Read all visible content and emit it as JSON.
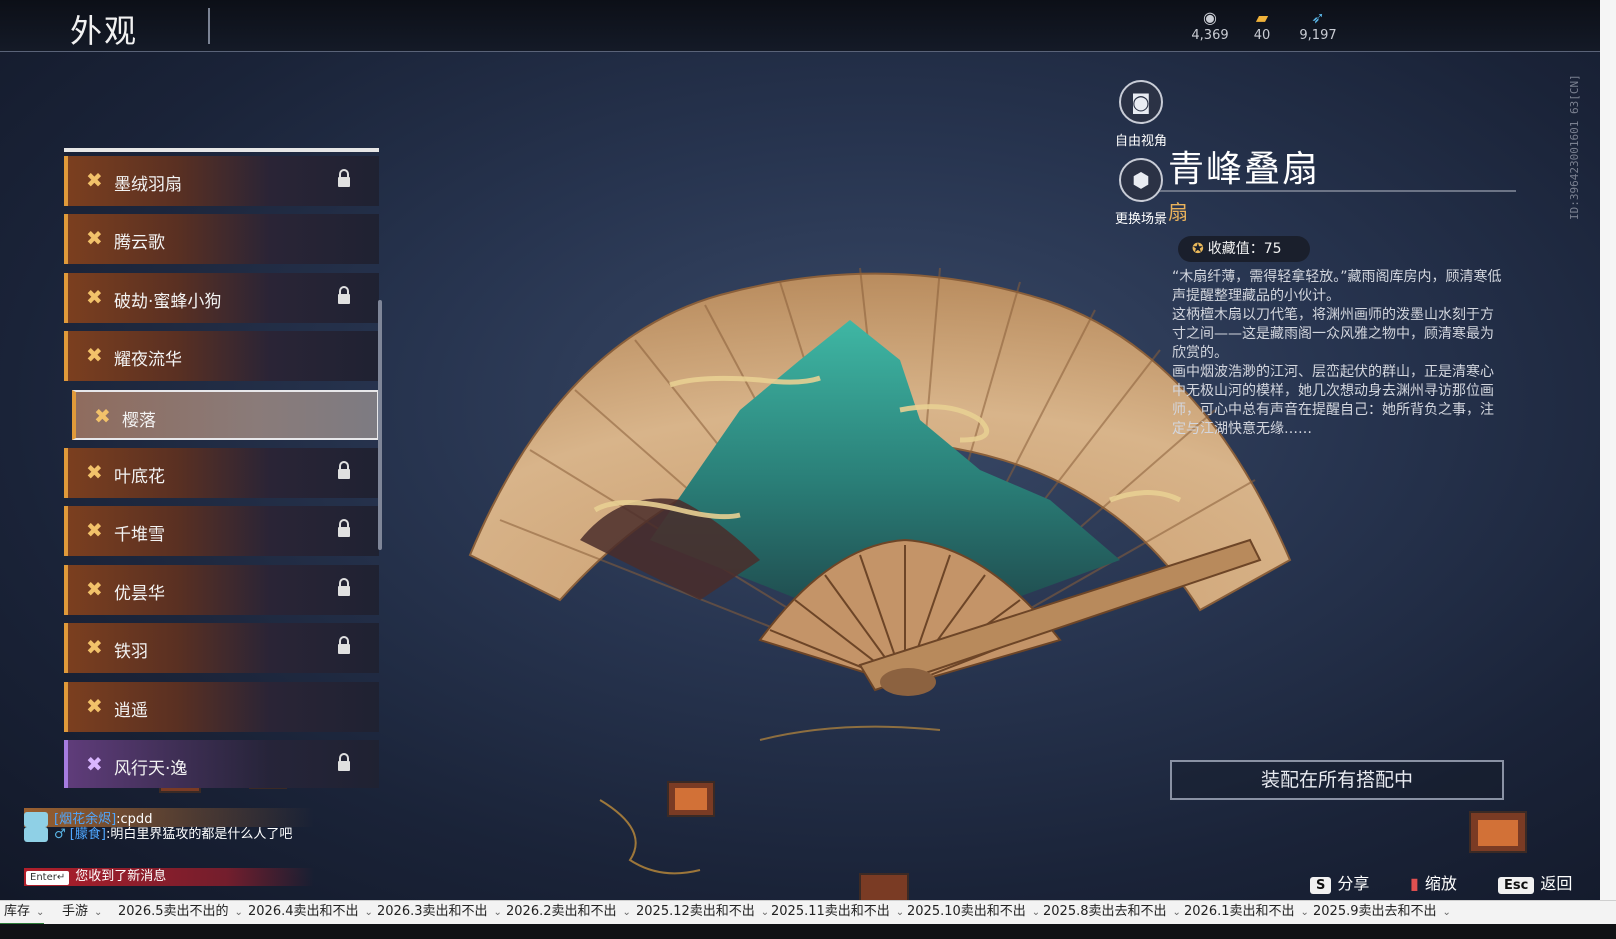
{
  "header": {
    "title": "外观",
    "currencies": [
      {
        "icon": "eye-currency-icon",
        "value": "4,369"
      },
      {
        "icon": "ticket-currency-icon",
        "value": "40"
      },
      {
        "icon": "feather-currency-icon",
        "value": "9,197"
      }
    ],
    "account_id": "ID:396423001601 63[CN]"
  },
  "tools": {
    "free_view": "自由视角",
    "change_scene": "更换场景"
  },
  "list": {
    "items": [
      {
        "label": "墨绒羽扇",
        "locked": true,
        "quality": "orange"
      },
      {
        "label": "腾云歌",
        "locked": false,
        "quality": "orange"
      },
      {
        "label": "破劫·蜜蜂小狗",
        "locked": true,
        "quality": "orange"
      },
      {
        "label": "耀夜流华",
        "locked": false,
        "quality": "orange"
      },
      {
        "label": "樱落",
        "locked": false,
        "quality": "orange",
        "selected": true
      },
      {
        "label": "叶底花",
        "locked": true,
        "quality": "orange"
      },
      {
        "label": "千堆雪",
        "locked": true,
        "quality": "orange"
      },
      {
        "label": "优昙华",
        "locked": true,
        "quality": "orange"
      },
      {
        "label": "铁羽",
        "locked": true,
        "quality": "orange"
      },
      {
        "label": "逍遥",
        "locked": false,
        "quality": "orange"
      },
      {
        "label": "风行天·逸",
        "locked": true,
        "quality": "purple"
      }
    ]
  },
  "detail": {
    "name": "青峰叠扇",
    "type": "扇",
    "collection_label": "收藏值：75",
    "description": [
      "“木扇纤薄，需得轻拿轻放。”藏雨阁库房内，顾清寒低声提醒整理藏品的小伙计。",
      "这柄檀木扇以刀代笔，将渊州画师的泼墨山水刻于方寸之间——这是藏雨阁一众风雅之物中，顾清寒最为欣赏的。",
      "画中烟波浩渺的江河、层峦起伏的群山，正是清寒心中无极山河的模样，她几次想动身去渊州寻访那位画师，可心中总有声音在提醒自己：她所背负之事，注定与江湖快意无缘……"
    ],
    "equip_button": "装配在所有搭配中"
  },
  "hints": {
    "share_key": "S",
    "share_label": "分享",
    "zoom_label": "缩放",
    "back_key": "Esc",
    "back_label": "返回"
  },
  "chat": {
    "line1_channel": "[烟花余烬]",
    "line1_text": ":cpdd",
    "line2_channel": "[朦食]",
    "line2_text": ":明白里界猛攻的都是什么人了吧",
    "enter_key": "Enter↵",
    "new_message": "您收到了新消息"
  },
  "tabs": [
    "库存",
    "手游",
    "2026.5卖出不出的",
    "2026.4卖出和不出",
    "2026.3卖出和不出",
    "2026.2卖出和不出",
    "2025.12卖出和不出",
    "2025.11卖出和不出",
    "2025.10卖出和不出",
    "2025.8卖出去和不出",
    "2026.1卖出和不出",
    "2025.9卖出去和不出"
  ],
  "colors": {
    "accent_orange": "#e09a3a",
    "accent_purple": "#a67ce0",
    "type_gold": "#eab25b",
    "lock_icon": "#e0e0e0"
  }
}
